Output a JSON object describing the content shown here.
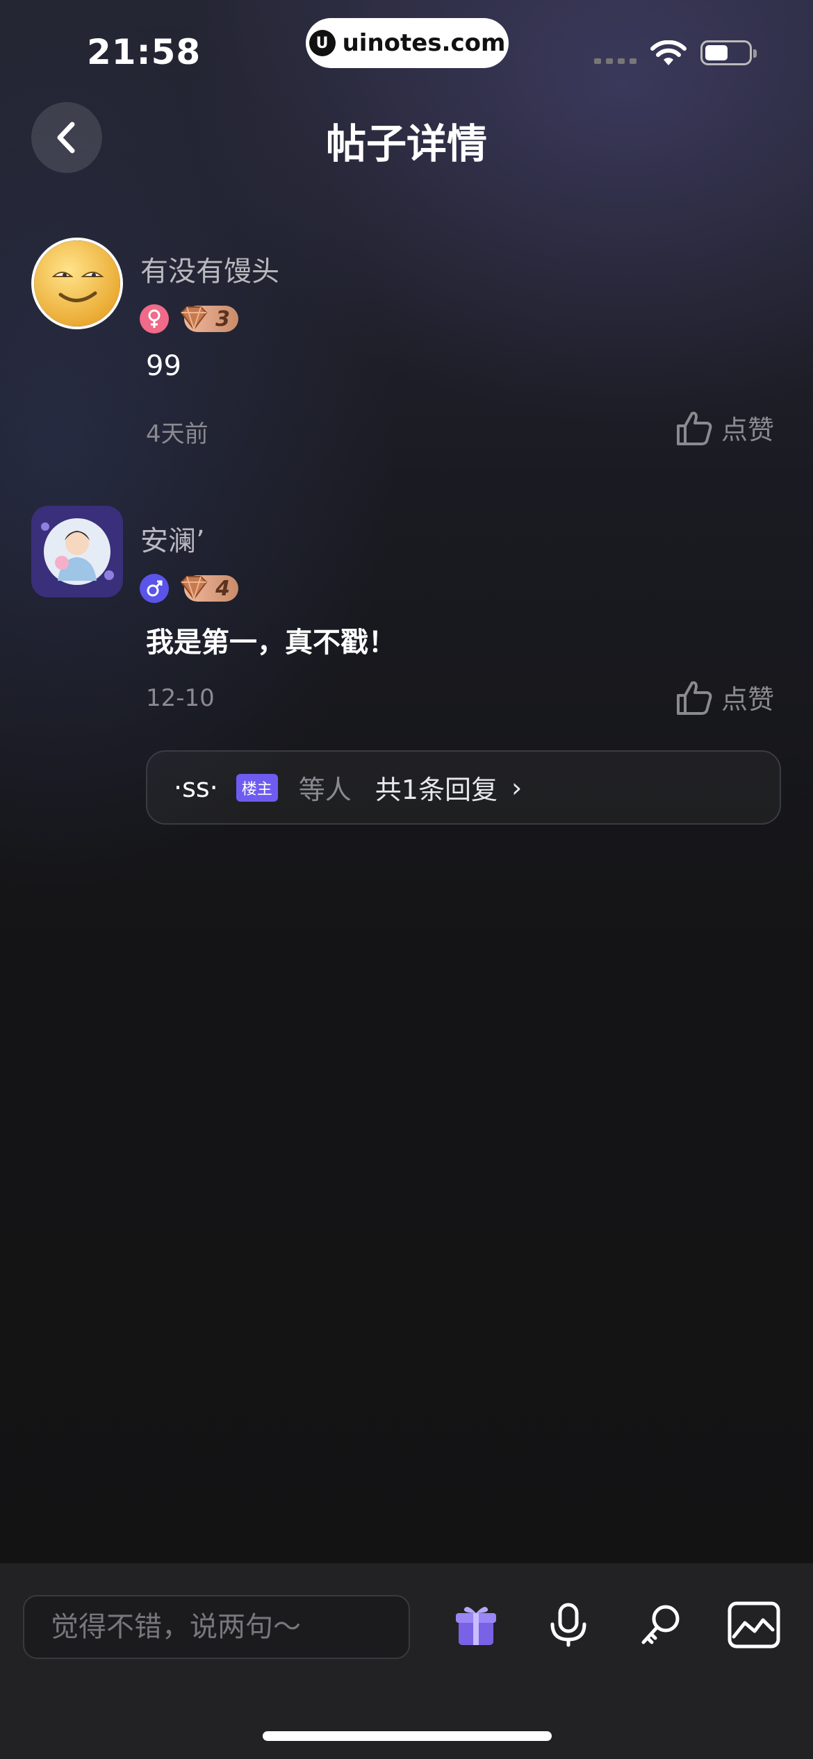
{
  "status_bar": {
    "time": "21:58",
    "watermark": "uinotes.com",
    "watermark_logo": "U"
  },
  "header": {
    "title": "帖子详情",
    "back_icon": "chevron-left-icon"
  },
  "comments": [
    {
      "username": "有没有馒头",
      "gender_icon": "female-icon",
      "gender_color": "#f06a8a",
      "level": "3",
      "content": "99",
      "time": "4天前",
      "like_label": "点赞"
    },
    {
      "username": "安澜’",
      "gender_icon": "male-icon",
      "gender_color": "#5b54e8",
      "level": "4",
      "content": "我是第一，真不戳！",
      "time": "12-10",
      "like_label": "点赞"
    }
  ],
  "reply_summary": {
    "replier": "·ss·",
    "host_badge": "楼主",
    "others": "等人",
    "total": "共1条回复",
    "chevron": "›"
  },
  "bottom_bar": {
    "input_placeholder": "觉得不错，说两句～",
    "tools": [
      "gift-icon",
      "microphone-icon",
      "key-icon",
      "image-icon"
    ]
  },
  "colors": {
    "accent": "#6e5cf0",
    "background": "#141416",
    "level_badge": "#e0a585"
  }
}
